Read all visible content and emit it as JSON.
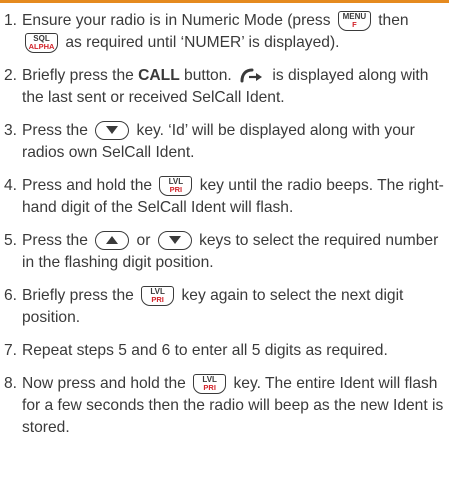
{
  "steps": [
    {
      "num": "1.",
      "a": "Ensure your radio is in Numeric Mode (press ",
      "b": " then",
      "c": " as required until ‘NUMER’ is displayed)."
    },
    {
      "num": "2.",
      "a": "Briefly press the ",
      "bold": "CALL",
      "b": " button. ",
      "c": " is displayed along with the last sent or received SelCall Ident."
    },
    {
      "num": "3.",
      "a": "Press the ",
      "b": " key. ‘Id’ will be displayed along with your radios own SelCall Ident."
    },
    {
      "num": "4.",
      "a": "Press and hold the ",
      "b": " key until the radio beeps. The right-hand digit of the SelCall Ident will flash."
    },
    {
      "num": "5.",
      "a": "Press the ",
      "b": " or ",
      "c": " keys to select the required number in the flashing digit position."
    },
    {
      "num": "6.",
      "a": "Briefly press the ",
      "b": " key again to select the next digit position."
    },
    {
      "num": "7.",
      "a": "Repeat steps 5 and 6 to enter all 5 digits as required."
    },
    {
      "num": "8.",
      "a": "Now press and hold the ",
      "b": " key. The entire Ident will flash for a few seconds then the radio will beep as the new Ident is stored."
    }
  ],
  "keys": {
    "menu_top": "MENU",
    "menu_bottom": "F",
    "sql_top": "SQL",
    "sql_bottom": "ALPHA",
    "lvl_top": "LVL",
    "lvl_bottom": "PRI"
  },
  "icons": {
    "call": "call-send-icon",
    "up": "up-arrow-key-icon",
    "down": "down-arrow-key-icon"
  },
  "colors": {
    "accent": "#e58a1f",
    "key_red": "#d2232a",
    "text": "#3a3a3a"
  }
}
